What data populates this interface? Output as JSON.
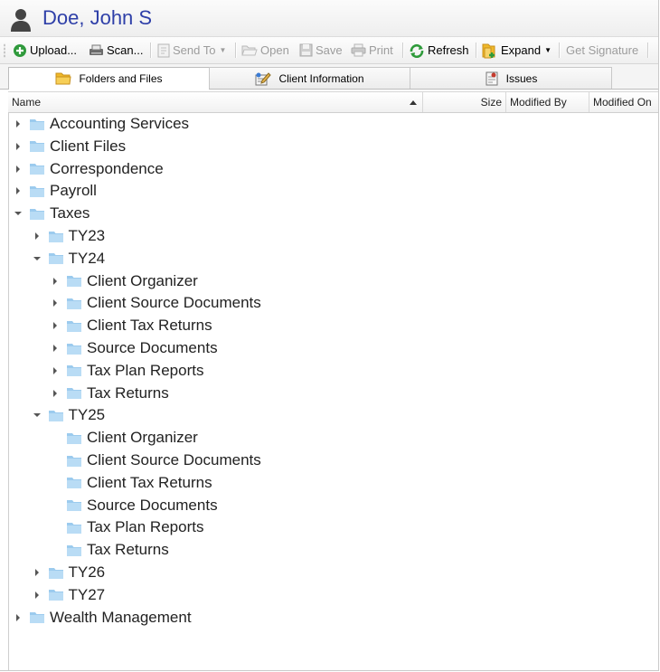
{
  "header": {
    "title": "Doe, John S"
  },
  "toolbar": {
    "upload": "Upload...",
    "scan": "Scan...",
    "send_to": "Send To",
    "open": "Open",
    "save": "Save",
    "print": "Print",
    "refresh": "Refresh",
    "expand": "Expand",
    "get_signature": "Get Signature"
  },
  "tabs": [
    {
      "label": "Folders and Files"
    },
    {
      "label": "Client Information"
    },
    {
      "label": "Issues"
    }
  ],
  "columns": {
    "name": "Name",
    "size": "Size",
    "modified_by": "Modified By",
    "modified_on": "Modified On"
  },
  "tree": [
    {
      "label": "Accounting Services",
      "depth": 0,
      "state": "collapsed"
    },
    {
      "label": "Client Files",
      "depth": 0,
      "state": "collapsed"
    },
    {
      "label": "Correspondence",
      "depth": 0,
      "state": "collapsed"
    },
    {
      "label": "Payroll",
      "depth": 0,
      "state": "collapsed"
    },
    {
      "label": "Taxes",
      "depth": 0,
      "state": "expanded"
    },
    {
      "label": "TY23",
      "depth": 1,
      "state": "collapsed"
    },
    {
      "label": "TY24",
      "depth": 1,
      "state": "expanded"
    },
    {
      "label": "Client Organizer",
      "depth": 2,
      "state": "collapsed"
    },
    {
      "label": "Client Source Documents",
      "depth": 2,
      "state": "collapsed"
    },
    {
      "label": "Client Tax Returns",
      "depth": 2,
      "state": "collapsed"
    },
    {
      "label": "Source Documents",
      "depth": 2,
      "state": "collapsed"
    },
    {
      "label": "Tax Plan Reports",
      "depth": 2,
      "state": "collapsed"
    },
    {
      "label": "Tax Returns",
      "depth": 2,
      "state": "collapsed"
    },
    {
      "label": "TY25",
      "depth": 1,
      "state": "expanded"
    },
    {
      "label": "Client Organizer",
      "depth": 2,
      "state": "leaf"
    },
    {
      "label": "Client Source Documents",
      "depth": 2,
      "state": "leaf"
    },
    {
      "label": "Client Tax Returns",
      "depth": 2,
      "state": "leaf"
    },
    {
      "label": "Source Documents",
      "depth": 2,
      "state": "leaf"
    },
    {
      "label": "Tax Plan Reports",
      "depth": 2,
      "state": "leaf"
    },
    {
      "label": "Tax Returns",
      "depth": 2,
      "state": "leaf"
    },
    {
      "label": "TY26",
      "depth": 1,
      "state": "collapsed"
    },
    {
      "label": "TY27",
      "depth": 1,
      "state": "collapsed"
    },
    {
      "label": "Wealth Management",
      "depth": 0,
      "state": "collapsed"
    }
  ],
  "colors": {
    "title": "#2e3fa8",
    "folder": "#b9dcf5",
    "folder_tab": "#9ccbee",
    "refresh": "#2e9a3a",
    "upload": "#2f9a3c"
  }
}
